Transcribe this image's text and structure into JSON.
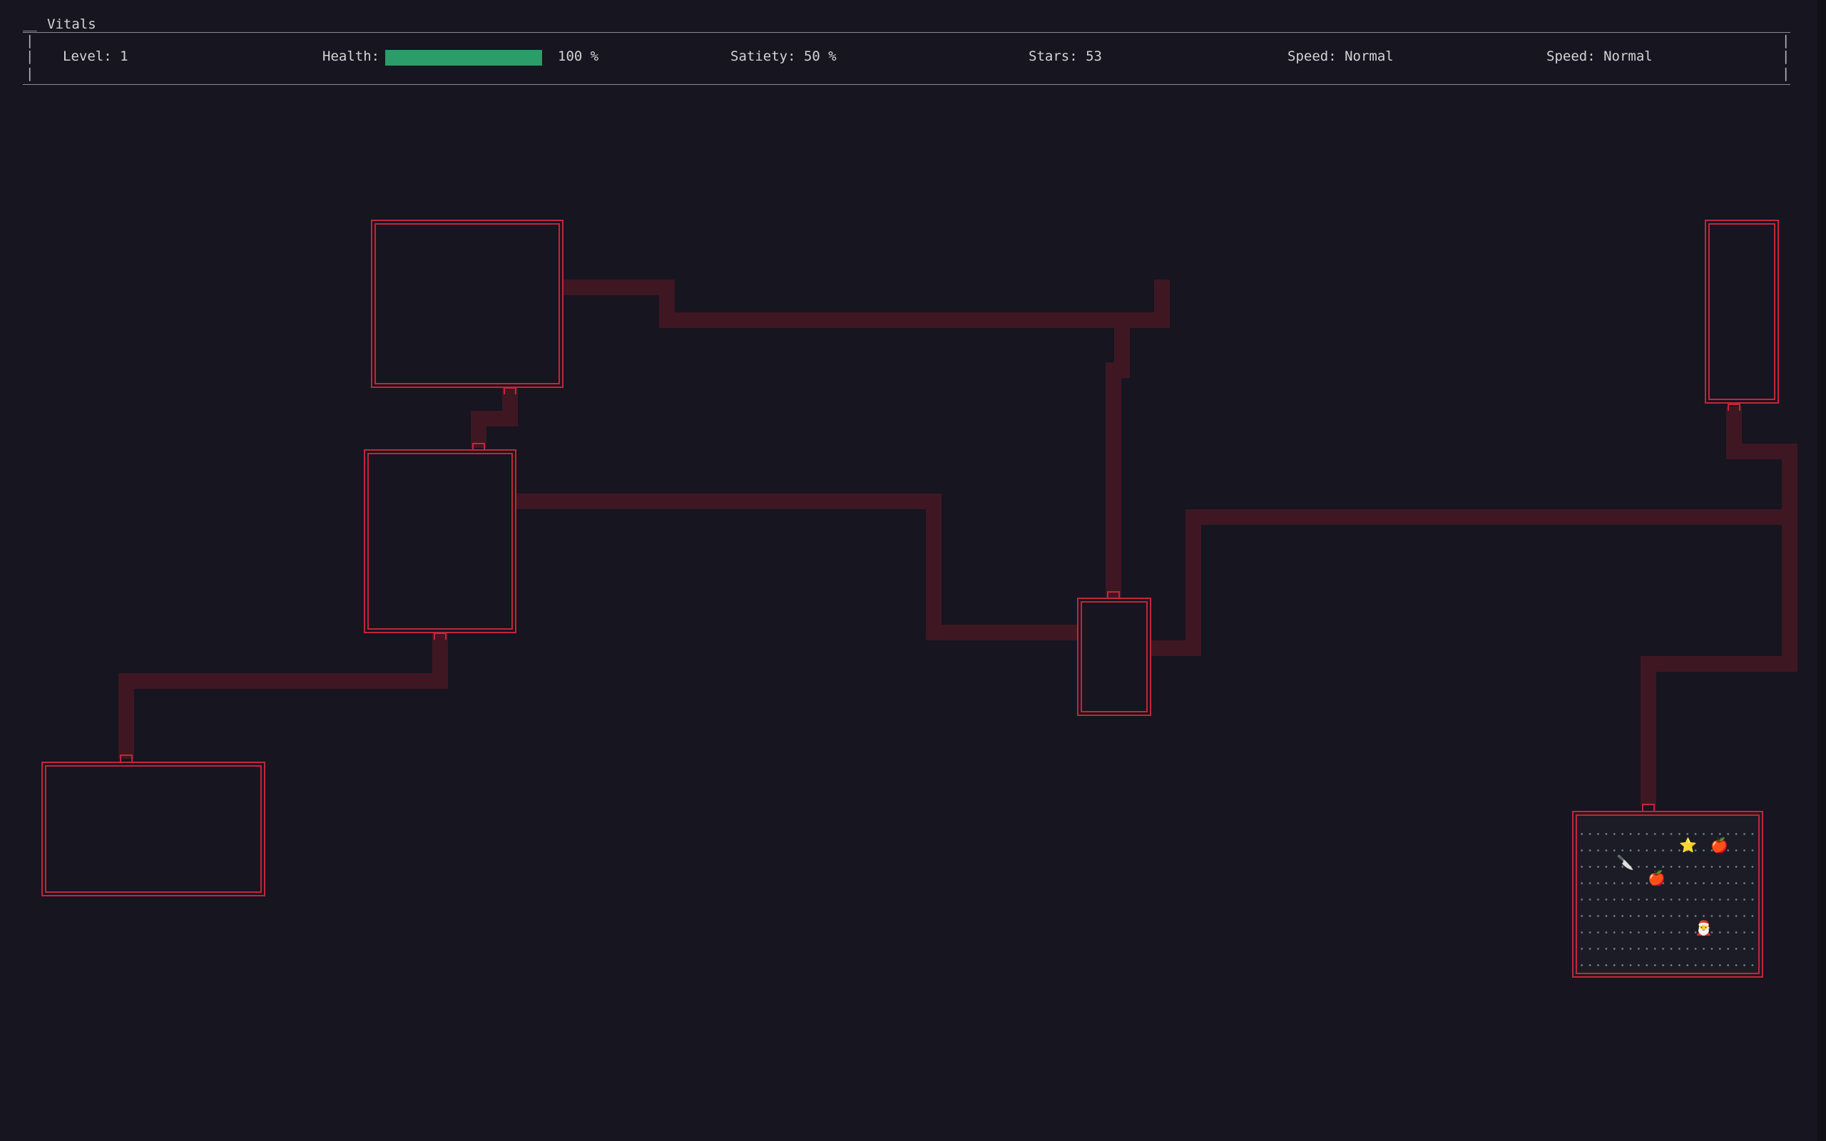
{
  "vitals": {
    "title": "Vitals",
    "level": "Level: 1",
    "health_label": "Health:",
    "health_value": "100 %",
    "health_fraction": 1.0,
    "satiety": "Satiety: 50 %",
    "stars": "Stars: 53",
    "speed_1": "Speed: Normal",
    "speed_2": "Speed: Normal"
  },
  "colors": {
    "background": "#161520",
    "wall": "#c4253a",
    "corridor": "#3e1722",
    "health_bar": "#2a9d68"
  },
  "entities": {
    "star": "⭐",
    "apple_1": "🍎",
    "apple_2": "🍎",
    "knife": "🔪",
    "player": "🎅"
  }
}
